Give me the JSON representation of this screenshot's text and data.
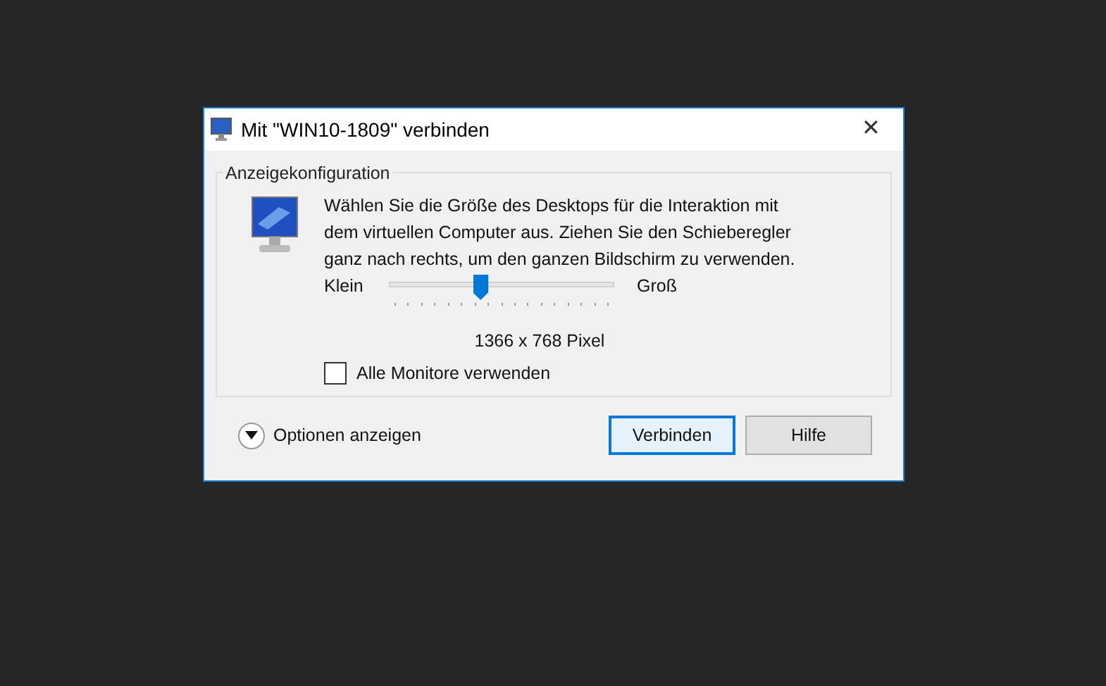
{
  "window": {
    "title": "Mit \"WIN10-1809\" verbinden",
    "close": "✕"
  },
  "group": {
    "title": "Anzeigekonfiguration",
    "description": "Wählen Sie die Größe des Desktops für die Interaktion mit dem virtuellen Computer aus. Ziehen Sie den Schieberegler ganz nach rechts, um den ganzen Bildschirm zu verwenden.",
    "slider": {
      "min_label": "Klein",
      "max_label": "Groß",
      "level": 0.4
    },
    "resolution": "1366 x 768 Pixel",
    "checkbox": {
      "label": "Alle Monitore verwenden",
      "checked": false
    }
  },
  "options": {
    "label": "Optionen anzeigen",
    "expanded": false
  },
  "buttons": [
    {
      "label": "Verbinden",
      "default": true
    },
    {
      "label": "Hilfe",
      "default": false
    }
  ]
}
